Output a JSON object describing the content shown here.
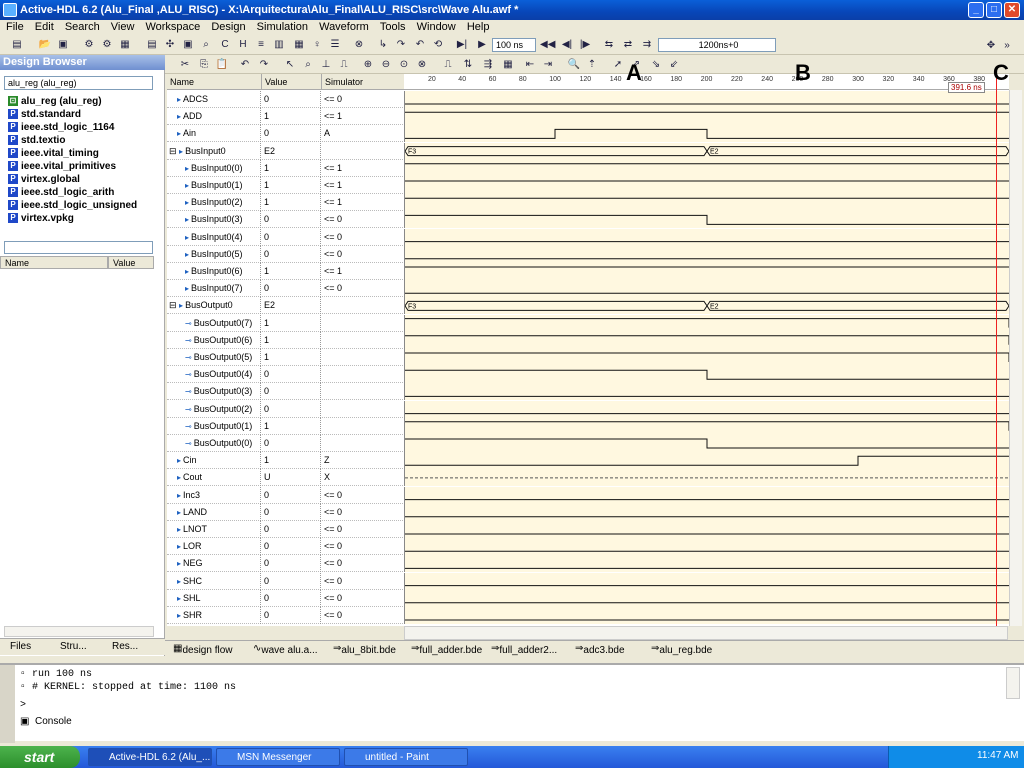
{
  "window": {
    "title": "Active-HDL 6.2 (Alu_Final ,ALU_RISC) - X:\\Arquitectura\\Alu_Final\\ALU_RISC\\src\\Wave Alu.awf *"
  },
  "menu": [
    "File",
    "Edit",
    "Search",
    "View",
    "Workspace",
    "Design",
    "Simulation",
    "Waveform",
    "Tools",
    "Window",
    "Help"
  ],
  "toolbar": {
    "run_step": "100 ns",
    "time_readout": "1200ns+0"
  },
  "design_browser": {
    "title": "Design Browser",
    "selected_unit": "alu_reg (alu_reg)",
    "tree": [
      "alu_reg (alu_reg)",
      "std.standard",
      "ieee.std_logic_1164",
      "std.textio",
      "ieee.vital_timing",
      "ieee.vital_primitives",
      "virtex.global",
      "ieee.std_logic_arith",
      "ieee.std_logic_unsigned",
      "virtex.vpkg"
    ],
    "lower_headers": {
      "name": "Name",
      "value": "Value"
    },
    "tabs": [
      "Files",
      "Stru...",
      "Res..."
    ]
  },
  "wave": {
    "headers": {
      "name": "Name",
      "value": "Value",
      "simulator": "Simulator"
    },
    "ruler": [
      "20",
      "40",
      "60",
      "80",
      "100",
      "120",
      "140",
      "160",
      "180",
      "200",
      "220",
      "240",
      "260",
      "280",
      "300",
      "320",
      "340",
      "360",
      "380"
    ],
    "cursor_label": "391.6 ns",
    "rows": [
      {
        "name": "ADCS",
        "value": "0",
        "sim": "<= 0",
        "indent": 0,
        "bus": false
      },
      {
        "name": "ADD",
        "value": "1",
        "sim": "<= 1",
        "indent": 0,
        "bus": false
      },
      {
        "name": "Ain",
        "value": "0",
        "sim": "A",
        "indent": 0,
        "bus": false
      },
      {
        "name": "BusInput0",
        "value": "E2",
        "sim": "",
        "indent": 0,
        "bus": true
      },
      {
        "name": "BusInput0(0)",
        "value": "1",
        "sim": "<= 1",
        "indent": 1,
        "bus": false
      },
      {
        "name": "BusInput0(1)",
        "value": "1",
        "sim": "<= 1",
        "indent": 1,
        "bus": false
      },
      {
        "name": "BusInput0(2)",
        "value": "1",
        "sim": "<= 1",
        "indent": 1,
        "bus": false
      },
      {
        "name": "BusInput0(3)",
        "value": "0",
        "sim": "<= 0",
        "indent": 1,
        "bus": false
      },
      {
        "name": "BusInput0(4)",
        "value": "0",
        "sim": "<= 0",
        "indent": 1,
        "bus": false
      },
      {
        "name": "BusInput0(5)",
        "value": "0",
        "sim": "<= 0",
        "indent": 1,
        "bus": false
      },
      {
        "name": "BusInput0(6)",
        "value": "1",
        "sim": "<= 1",
        "indent": 1,
        "bus": false
      },
      {
        "name": "BusInput0(7)",
        "value": "0",
        "sim": "<= 0",
        "indent": 1,
        "bus": false
      },
      {
        "name": "BusOutput0",
        "value": "E2",
        "sim": "",
        "indent": 0,
        "bus": true
      },
      {
        "name": "BusOutput0(7)",
        "value": "1",
        "sim": "",
        "indent": 1,
        "bus": false
      },
      {
        "name": "BusOutput0(6)",
        "value": "1",
        "sim": "",
        "indent": 1,
        "bus": false
      },
      {
        "name": "BusOutput0(5)",
        "value": "1",
        "sim": "",
        "indent": 1,
        "bus": false
      },
      {
        "name": "BusOutput0(4)",
        "value": "0",
        "sim": "",
        "indent": 1,
        "bus": false
      },
      {
        "name": "BusOutput0(3)",
        "value": "0",
        "sim": "",
        "indent": 1,
        "bus": false
      },
      {
        "name": "BusOutput0(2)",
        "value": "0",
        "sim": "",
        "indent": 1,
        "bus": false
      },
      {
        "name": "BusOutput0(1)",
        "value": "1",
        "sim": "",
        "indent": 1,
        "bus": false
      },
      {
        "name": "BusOutput0(0)",
        "value": "0",
        "sim": "",
        "indent": 1,
        "bus": false
      },
      {
        "name": "Cin",
        "value": "1",
        "sim": "Z",
        "indent": 0,
        "bus": false
      },
      {
        "name": "Cout",
        "value": "U",
        "sim": "X",
        "indent": 0,
        "bus": false
      },
      {
        "name": "Inc3",
        "value": "0",
        "sim": "<= 0",
        "indent": 0,
        "bus": false
      },
      {
        "name": "LAND",
        "value": "0",
        "sim": "<= 0",
        "indent": 0,
        "bus": false
      },
      {
        "name": "LNOT",
        "value": "0",
        "sim": "<= 0",
        "indent": 0,
        "bus": false
      },
      {
        "name": "LOR",
        "value": "0",
        "sim": "<= 0",
        "indent": 0,
        "bus": false
      },
      {
        "name": "NEG",
        "value": "0",
        "sim": "<= 0",
        "indent": 0,
        "bus": false
      },
      {
        "name": "SHC",
        "value": "0",
        "sim": "<= 0",
        "indent": 0,
        "bus": false
      },
      {
        "name": "SHL",
        "value": "0",
        "sim": "<= 0",
        "indent": 0,
        "bus": false
      },
      {
        "name": "SHR",
        "value": "0",
        "sim": "<= 0",
        "indent": 0,
        "bus": false
      }
    ],
    "bus_values": {
      "before": "F3",
      "after": "E2"
    }
  },
  "annotations": [
    "A",
    "B",
    "C"
  ],
  "doc_tabs": [
    "design flow",
    "wave alu.a...",
    "alu_8bit.bde",
    "full_adder.bde",
    "full_adder2...",
    "adc3.bde",
    "alu_reg.bde"
  ],
  "console": {
    "lines": [
      "run 100 ns",
      "# KERNEL: stopped at time: 1100 ns"
    ],
    "prompt": ">",
    "tab": "Console"
  },
  "taskbar": {
    "start": "start",
    "tasks": [
      "Active-HDL 6.2 (Alu_...",
      "MSN Messenger",
      "untitled - Paint"
    ],
    "clock": "11:47 AM"
  }
}
